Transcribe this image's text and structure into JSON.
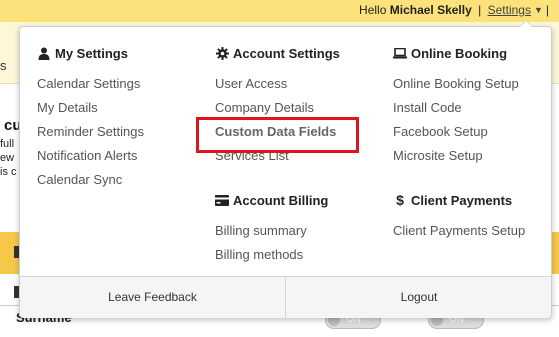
{
  "topbar": {
    "greeting": "Hello",
    "user_name": "Michael Skelly",
    "separator": "|",
    "settings_label": "Settings",
    "trailing_bar": "|"
  },
  "background": {
    "nav_fragment": "s",
    "heading_fragment": "cu",
    "line_fragments": [
      "full",
      "ew",
      "is c"
    ],
    "surname_label": "Surname",
    "toggle_label": "ON"
  },
  "menu": {
    "columns": [
      {
        "sections": [
          {
            "title": "My Settings",
            "icon": "user-icon",
            "items": [
              "Calendar Settings",
              "My Details",
              "Reminder Settings",
              "Notification Alerts",
              "Calendar Sync"
            ]
          }
        ]
      },
      {
        "sections": [
          {
            "title": "Account Settings",
            "icon": "gear-icon",
            "items": [
              "User Access",
              "Company Details",
              "Custom Data Fields",
              "Services List"
            ]
          },
          {
            "title": "Account Billing",
            "icon": "credit-card-icon",
            "items": [
              "Billing summary",
              "Billing methods"
            ]
          }
        ]
      },
      {
        "sections": [
          {
            "title": "Online Booking",
            "icon": "laptop-icon",
            "items": [
              "Online Booking Setup",
              "Install Code",
              "Facebook Setup",
              "Microsite Setup"
            ]
          },
          {
            "title": "Client Payments",
            "icon": "dollar-icon",
            "items": [
              "Client Payments Setup"
            ]
          }
        ]
      }
    ],
    "highlighted_item": "Custom Data Fields",
    "highlight_color": "#e0141e",
    "footer": {
      "left_label": "Leave Feedback",
      "right_label": "Logout"
    }
  }
}
